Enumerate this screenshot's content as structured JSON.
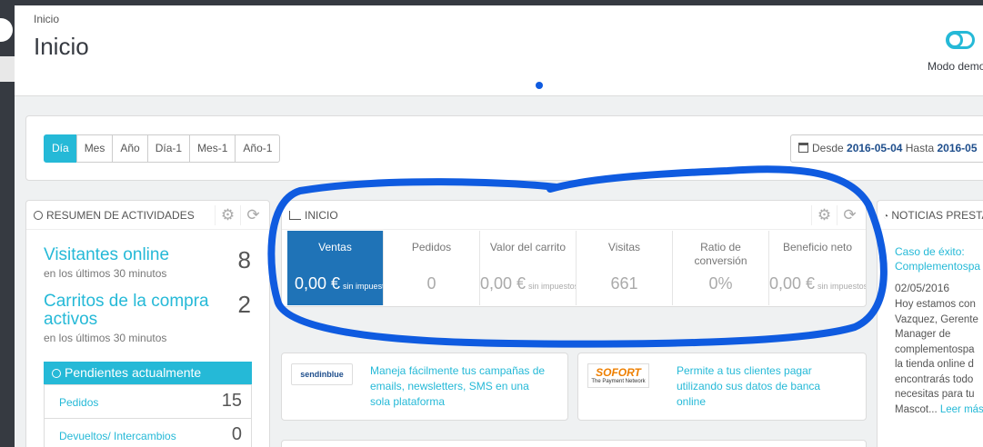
{
  "header": {
    "breadcrumb": "Inicio",
    "title": "Inicio",
    "demo_label": "Modo demo"
  },
  "filters": {
    "buttons": [
      {
        "label": "Día",
        "active": true
      },
      {
        "label": "Mes",
        "active": false
      },
      {
        "label": "Año",
        "active": false
      },
      {
        "label": "Día-1",
        "active": false
      },
      {
        "label": "Mes-1",
        "active": false
      },
      {
        "label": "Año-1",
        "active": false
      }
    ],
    "date_from_label": "Desde",
    "date_from": "2016-05-04",
    "date_to_label": "Hasta",
    "date_to": "2016-05"
  },
  "activity": {
    "title": "RESUMEN DE ACTIVIDADES",
    "visitors_label": "Visitantes online",
    "visitors_sub": "en los últimos 30 minutos",
    "visitors_value": "8",
    "carts_label": "Carritos de la compra activos",
    "carts_sub": "en los últimos 30 minutos",
    "carts_value": "2",
    "pending_title": "Pendientes actualmente",
    "pending": [
      {
        "label": "Pedidos",
        "value": "15"
      },
      {
        "label": "Devueltos/ Intercambios",
        "value": "0"
      }
    ]
  },
  "kpi": {
    "title": "INICIO",
    "cells": [
      {
        "label": "Ventas",
        "value": "0,00 €",
        "suffix": "sin impuestos"
      },
      {
        "label": "Pedidos",
        "value": "0",
        "suffix": ""
      },
      {
        "label": "Valor del carrito",
        "value": "0,00 €",
        "suffix": "sin impuestos"
      },
      {
        "label": "Visitas",
        "value": "661",
        "suffix": ""
      },
      {
        "label": "Ratio de conversión",
        "value": "0%",
        "suffix": ""
      },
      {
        "label": "Beneficio neto",
        "value": "0,00 €",
        "suffix": "sin impuestos"
      }
    ]
  },
  "promos": [
    {
      "logo": "sendinblue",
      "text": "Maneja fácilmente tus campañas de emails, newsletters, SMS en una sola plataforma"
    },
    {
      "logo_main": "SOFORT",
      "logo_sub": "The Payment Network",
      "text": "Permite a tus clientes pagar utilizando sus datos de banca online"
    }
  ],
  "news": {
    "title": "NOTICIAS PRESTASHOP",
    "item_title": "Caso de éxito: Complementospa",
    "item_date": "02/05/2016",
    "item_lines": [
      "Hoy estamos con",
      "Vazquez, Gerente",
      "Manager de",
      "complementospa",
      "la tienda online d",
      "encontrarás todo",
      "necesitas para tu",
      "Mascot..."
    ],
    "read_more": "Leer más"
  },
  "colors": {
    "accent": "#25b9d7",
    "active_kpi": "#1f73b7",
    "dark": "#363a41",
    "scribble": "#0f5be0"
  }
}
